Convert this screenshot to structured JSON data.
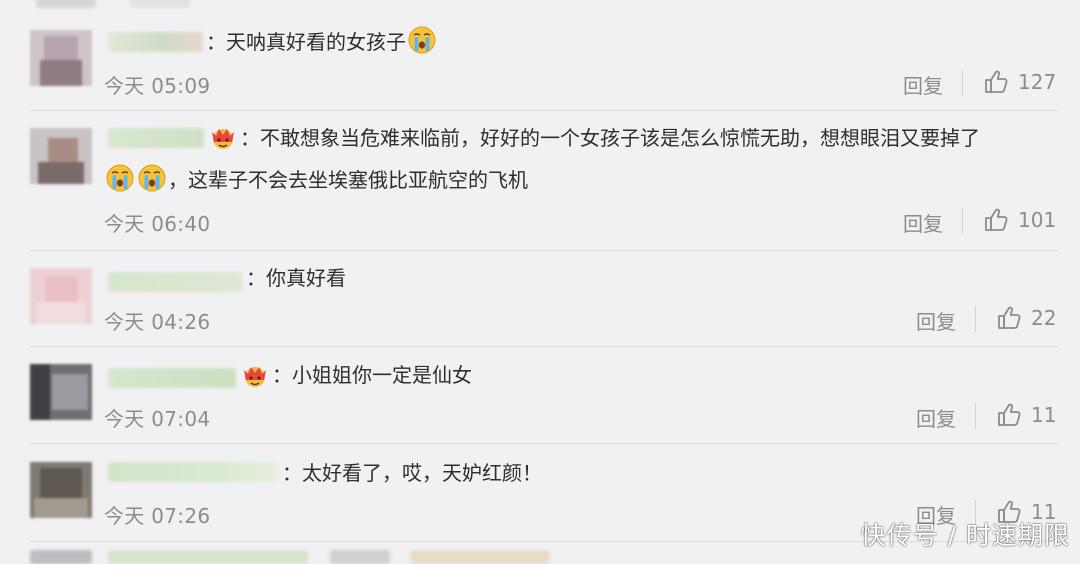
{
  "comments": [
    {
      "text": "：天呐真好看的女孩子",
      "time": "今天 05:09",
      "reply": "回复",
      "likes": "127"
    },
    {
      "text_line1": "：不敢想象当危难来临前，好好的一个女孩子该是怎么惊慌无助，想想眼泪又要掉了",
      "text_line2": "，这辈子不会去坐埃塞俄比亚航空的飞机",
      "time": "今天 06:40",
      "reply": "回复",
      "likes": "101"
    },
    {
      "text": "：你真好看",
      "time": "今天 04:26",
      "reply": "回复",
      "likes": "22"
    },
    {
      "text": "：小姐姐你一定是仙女",
      "time": "今天 07:04",
      "reply": "回复",
      "likes": "11"
    },
    {
      "text": "：太好看了，哎，天妒红颜！",
      "time": "今天 07:26",
      "reply": "回复",
      "likes": "11"
    }
  ],
  "watermark": "快传号 / 时速期限",
  "icons": {
    "like": "thumbs-up-icon",
    "emoji": "crying-face-emoji",
    "badge": "crown-badge-icon"
  },
  "colors": {
    "background": "#f1f1f3",
    "text": "#2e2e2e",
    "meta": "#8c8c90",
    "divider": "#dcdcdf"
  }
}
